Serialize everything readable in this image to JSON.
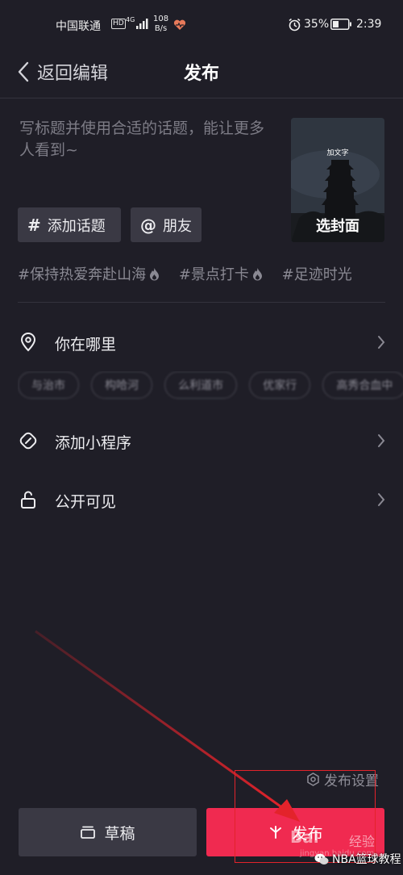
{
  "status_bar": {
    "carrier": "中国联通",
    "hd": "HD",
    "network_type": "4G",
    "speed_value": "108",
    "speed_unit": "B/s",
    "battery_percent": "35%",
    "time": "2:39"
  },
  "nav": {
    "back_label": "返回编辑",
    "title": "发布"
  },
  "caption": {
    "placeholder": "写标题并使用合适的话题，能让更多人看到~"
  },
  "cover": {
    "top_text": "加文字",
    "label": "选封面"
  },
  "chips": {
    "topic": {
      "icon": "#",
      "label": "添加话题"
    },
    "friend": {
      "icon": "@",
      "label": "朋友"
    }
  },
  "trending_tags": [
    {
      "text": "#保持热爱奔赴山海",
      "hot": true
    },
    {
      "text": "#景点打卡",
      "hot": true
    },
    {
      "text": "#足迹时光",
      "hot": false
    }
  ],
  "rows": {
    "location": {
      "label": "你在哪里",
      "icon": "location-pin-icon"
    },
    "mini_program": {
      "label": "添加小程序",
      "icon": "link-icon"
    },
    "visibility": {
      "label": "公开可见",
      "icon": "unlock-icon"
    }
  },
  "location_suggestions": [
    "与治市",
    "构哈河",
    "么利道市",
    "优家行",
    "高秀合血中"
  ],
  "footer": {
    "settings_label": "发布设置",
    "draft_label": "草稿",
    "publish_label": "发布"
  },
  "watermarks": {
    "baidu": "Bai",
    "jingyan": "经验",
    "url": "jingyan.baidu.com",
    "account": "NBA篮球教程"
  },
  "colors": {
    "background": "#1f1e27",
    "publish_button": "#f02a50",
    "chip_background": "#3a3944",
    "annotation": "#e3232b"
  }
}
